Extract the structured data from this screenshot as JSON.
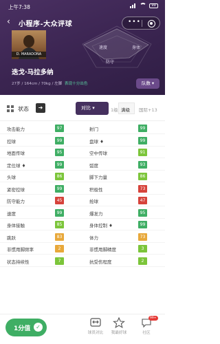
{
  "status_bar": {
    "time": "上午7:38",
    "battery": "99"
  },
  "nav": {
    "back": "‹",
    "title": "小程序-大众评球",
    "capsule_dots": "•••"
  },
  "player": {
    "photo_tag": "D. MARADONA",
    "name": "迭戈·马拉多纳",
    "info": "27岁 / 164cm / 70kg / 左脚",
    "info_highlight": "表现十分出色",
    "action": "队数 ▾"
  },
  "radar": {
    "labels": [
      "速度",
      "身体",
      "防守"
    ]
  },
  "tabs": {
    "status_label": "状态",
    "arrow": "➜",
    "compare": "对比 ▾",
    "segments": [
      "1级",
      "满级",
      "国际+13"
    ]
  },
  "attributes": [
    {
      "left": {
        "label": "攻击能力",
        "value": "97",
        "color": "#3fae64"
      },
      "right": {
        "label": "射门",
        "value": "99",
        "color": "#3fae64"
      }
    },
    {
      "left": {
        "label": "控球",
        "value": "99",
        "color": "#3fae64"
      },
      "right": {
        "label": "盘球 ♦",
        "value": "99",
        "color": "#3fae64"
      }
    },
    {
      "left": {
        "label": "地面传球",
        "value": "95",
        "color": "#3fae64"
      },
      "right": {
        "label": "空中传球",
        "value": "91",
        "color": "#7cc53a"
      }
    },
    {
      "left": {
        "label": "定位球 ♦",
        "value": "99",
        "color": "#3fae64"
      },
      "right": {
        "label": "弧度",
        "value": "93",
        "color": "#3fae64"
      }
    },
    {
      "left": {
        "label": "头球",
        "value": "86",
        "color": "#7cc53a"
      },
      "right": {
        "label": "脚下力量",
        "value": "86",
        "color": "#7cc53a"
      }
    },
    {
      "left": {
        "label": "紧密控球",
        "value": "99",
        "color": "#3fae64"
      },
      "right": {
        "label": "积极性",
        "value": "73",
        "color": "#d6433b"
      }
    },
    {
      "left": {
        "label": "防守能力",
        "value": "45",
        "color": "#d6433b"
      },
      "right": {
        "label": "抢球",
        "value": "47",
        "color": "#d6433b"
      }
    },
    {
      "left": {
        "label": "速度",
        "value": "99",
        "color": "#3fae64"
      },
      "right": {
        "label": "爆发力",
        "value": "95",
        "color": "#3fae64"
      }
    },
    {
      "left": {
        "label": "身体接触",
        "value": "85",
        "color": "#7cc53a"
      },
      "right": {
        "label": "身体控制 ♦",
        "value": "99",
        "color": "#3fae64"
      }
    },
    {
      "left": {
        "label": "跳跃",
        "value": "83",
        "color": "#e8a83a"
      },
      "right": {
        "label": "体力",
        "value": "73",
        "color": "#e8a83a"
      }
    },
    {
      "left": {
        "label": "非惯用脚频率",
        "value": "2",
        "color": "#e8a83a"
      },
      "right": {
        "label": "非惯用脚精度",
        "value": "3",
        "color": "#7cc53a"
      }
    },
    {
      "left": {
        "label": "状态持续性",
        "value": "7",
        "color": "#7cc53a"
      },
      "right": {
        "label": "抗受伤程度",
        "value": "2",
        "color": "#7cc53a"
      }
    }
  ],
  "bottom_bar": {
    "rate_label": "1分值",
    "items": [
      {
        "label": "球员对比",
        "icon": "compare-icon"
      },
      {
        "label": "我最好球",
        "icon": "star-icon"
      },
      {
        "label": "社区",
        "icon": "chat-icon",
        "badge": "99+"
      }
    ]
  }
}
